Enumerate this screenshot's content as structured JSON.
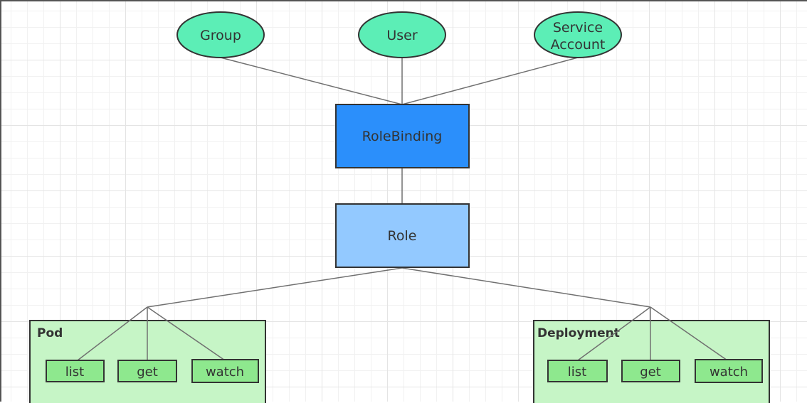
{
  "nodes": {
    "group": "Group",
    "user": "User",
    "service_account": [
      "Service",
      "Account"
    ],
    "rolebinding": "RoleBinding",
    "role": "Role",
    "pod": {
      "title": "Pod",
      "verbs": [
        "list",
        "get",
        "watch"
      ]
    },
    "deployment": {
      "title": "Deployment",
      "verbs": [
        "list",
        "get",
        "watch"
      ]
    }
  },
  "colors": {
    "subject": "#5ceeb6",
    "rolebinding": "#2b8ffb",
    "role": "#93c9ff",
    "resource": "#c6f5c6",
    "verb": "#8ee88e",
    "line": "#707070",
    "border": "#333333"
  }
}
